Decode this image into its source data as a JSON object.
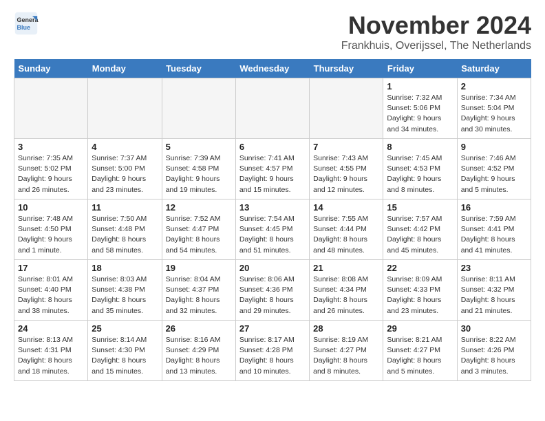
{
  "header": {
    "logo_line1": "General",
    "logo_line2": "Blue",
    "month_title": "November 2024",
    "location": "Frankhuis, Overijssel, The Netherlands"
  },
  "weekdays": [
    "Sunday",
    "Monday",
    "Tuesday",
    "Wednesday",
    "Thursday",
    "Friday",
    "Saturday"
  ],
  "weeks": [
    [
      {
        "day": "",
        "info": "",
        "empty": true
      },
      {
        "day": "",
        "info": "",
        "empty": true
      },
      {
        "day": "",
        "info": "",
        "empty": true
      },
      {
        "day": "",
        "info": "",
        "empty": true
      },
      {
        "day": "",
        "info": "",
        "empty": true
      },
      {
        "day": "1",
        "info": "Sunrise: 7:32 AM\nSunset: 5:06 PM\nDaylight: 9 hours\nand 34 minutes."
      },
      {
        "day": "2",
        "info": "Sunrise: 7:34 AM\nSunset: 5:04 PM\nDaylight: 9 hours\nand 30 minutes."
      }
    ],
    [
      {
        "day": "3",
        "info": "Sunrise: 7:35 AM\nSunset: 5:02 PM\nDaylight: 9 hours\nand 26 minutes."
      },
      {
        "day": "4",
        "info": "Sunrise: 7:37 AM\nSunset: 5:00 PM\nDaylight: 9 hours\nand 23 minutes."
      },
      {
        "day": "5",
        "info": "Sunrise: 7:39 AM\nSunset: 4:58 PM\nDaylight: 9 hours\nand 19 minutes."
      },
      {
        "day": "6",
        "info": "Sunrise: 7:41 AM\nSunset: 4:57 PM\nDaylight: 9 hours\nand 15 minutes."
      },
      {
        "day": "7",
        "info": "Sunrise: 7:43 AM\nSunset: 4:55 PM\nDaylight: 9 hours\nand 12 minutes."
      },
      {
        "day": "8",
        "info": "Sunrise: 7:45 AM\nSunset: 4:53 PM\nDaylight: 9 hours\nand 8 minutes."
      },
      {
        "day": "9",
        "info": "Sunrise: 7:46 AM\nSunset: 4:52 PM\nDaylight: 9 hours\nand 5 minutes."
      }
    ],
    [
      {
        "day": "10",
        "info": "Sunrise: 7:48 AM\nSunset: 4:50 PM\nDaylight: 9 hours\nand 1 minute."
      },
      {
        "day": "11",
        "info": "Sunrise: 7:50 AM\nSunset: 4:48 PM\nDaylight: 8 hours\nand 58 minutes."
      },
      {
        "day": "12",
        "info": "Sunrise: 7:52 AM\nSunset: 4:47 PM\nDaylight: 8 hours\nand 54 minutes."
      },
      {
        "day": "13",
        "info": "Sunrise: 7:54 AM\nSunset: 4:45 PM\nDaylight: 8 hours\nand 51 minutes."
      },
      {
        "day": "14",
        "info": "Sunrise: 7:55 AM\nSunset: 4:44 PM\nDaylight: 8 hours\nand 48 minutes."
      },
      {
        "day": "15",
        "info": "Sunrise: 7:57 AM\nSunset: 4:42 PM\nDaylight: 8 hours\nand 45 minutes."
      },
      {
        "day": "16",
        "info": "Sunrise: 7:59 AM\nSunset: 4:41 PM\nDaylight: 8 hours\nand 41 minutes."
      }
    ],
    [
      {
        "day": "17",
        "info": "Sunrise: 8:01 AM\nSunset: 4:40 PM\nDaylight: 8 hours\nand 38 minutes."
      },
      {
        "day": "18",
        "info": "Sunrise: 8:03 AM\nSunset: 4:38 PM\nDaylight: 8 hours\nand 35 minutes."
      },
      {
        "day": "19",
        "info": "Sunrise: 8:04 AM\nSunset: 4:37 PM\nDaylight: 8 hours\nand 32 minutes."
      },
      {
        "day": "20",
        "info": "Sunrise: 8:06 AM\nSunset: 4:36 PM\nDaylight: 8 hours\nand 29 minutes."
      },
      {
        "day": "21",
        "info": "Sunrise: 8:08 AM\nSunset: 4:34 PM\nDaylight: 8 hours\nand 26 minutes."
      },
      {
        "day": "22",
        "info": "Sunrise: 8:09 AM\nSunset: 4:33 PM\nDaylight: 8 hours\nand 23 minutes."
      },
      {
        "day": "23",
        "info": "Sunrise: 8:11 AM\nSunset: 4:32 PM\nDaylight: 8 hours\nand 21 minutes."
      }
    ],
    [
      {
        "day": "24",
        "info": "Sunrise: 8:13 AM\nSunset: 4:31 PM\nDaylight: 8 hours\nand 18 minutes."
      },
      {
        "day": "25",
        "info": "Sunrise: 8:14 AM\nSunset: 4:30 PM\nDaylight: 8 hours\nand 15 minutes."
      },
      {
        "day": "26",
        "info": "Sunrise: 8:16 AM\nSunset: 4:29 PM\nDaylight: 8 hours\nand 13 minutes."
      },
      {
        "day": "27",
        "info": "Sunrise: 8:17 AM\nSunset: 4:28 PM\nDaylight: 8 hours\nand 10 minutes."
      },
      {
        "day": "28",
        "info": "Sunrise: 8:19 AM\nSunset: 4:27 PM\nDaylight: 8 hours\nand 8 minutes."
      },
      {
        "day": "29",
        "info": "Sunrise: 8:21 AM\nSunset: 4:27 PM\nDaylight: 8 hours\nand 5 minutes."
      },
      {
        "day": "30",
        "info": "Sunrise: 8:22 AM\nSunset: 4:26 PM\nDaylight: 8 hours\nand 3 minutes."
      }
    ]
  ]
}
